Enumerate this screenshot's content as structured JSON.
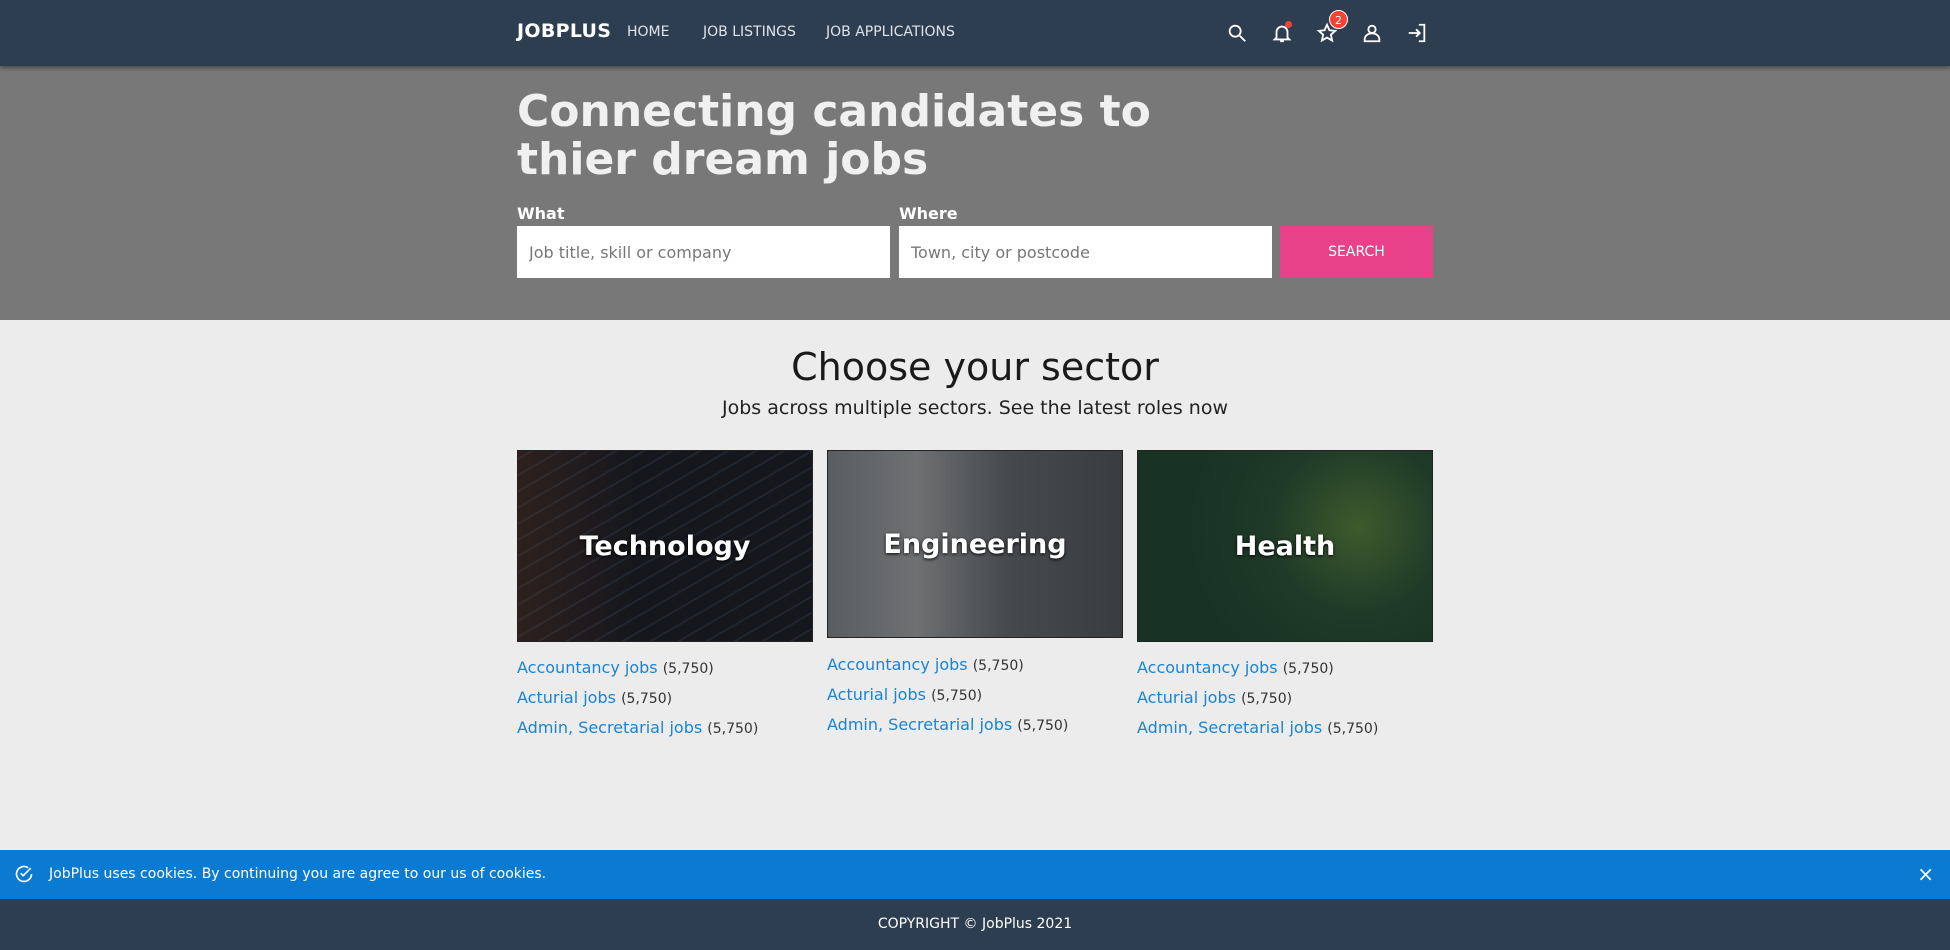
{
  "nav": {
    "brand": "JOBPLUS",
    "links": [
      "HOME",
      "JOB LISTINGS",
      "JOB APPLICATIONS"
    ],
    "favorites_count": "2"
  },
  "hero": {
    "title": "Connecting candidates to thier dream jobs",
    "what_label": "What",
    "what_placeholder": "Job title, skill or company",
    "where_label": "Where",
    "where_placeholder": "Town, city or postcode",
    "search_label": "SEARCH"
  },
  "sectors": {
    "title": "Choose your sector",
    "subtitle": "Jobs across multiple sectors. See the latest roles now",
    "cards": [
      {
        "name": "Technology",
        "links": [
          {
            "label": "Accountancy jobs",
            "count": "(5,750)"
          },
          {
            "label": "Acturial jobs",
            "count": "(5,750)"
          },
          {
            "label": "Admin, Secretarial jobs",
            "count": "(5,750)"
          }
        ]
      },
      {
        "name": "Engineering",
        "links": [
          {
            "label": "Accountancy jobs",
            "count": "(5,750)"
          },
          {
            "label": "Acturial jobs",
            "count": "(5,750)"
          },
          {
            "label": "Admin, Secretarial jobs",
            "count": "(5,750)"
          }
        ]
      },
      {
        "name": "Health",
        "links": [
          {
            "label": "Accountancy jobs",
            "count": "(5,750)"
          },
          {
            "label": "Acturial jobs",
            "count": "(5,750)"
          },
          {
            "label": "Admin, Secretarial jobs",
            "count": "(5,750)"
          }
        ]
      }
    ]
  },
  "cookie": {
    "text": "JobPlus uses cookies. By continuing you are agree to our us of cookies.",
    "close": "×"
  },
  "footer": {
    "text": "COPYRIGHT © JobPlus 2021"
  }
}
